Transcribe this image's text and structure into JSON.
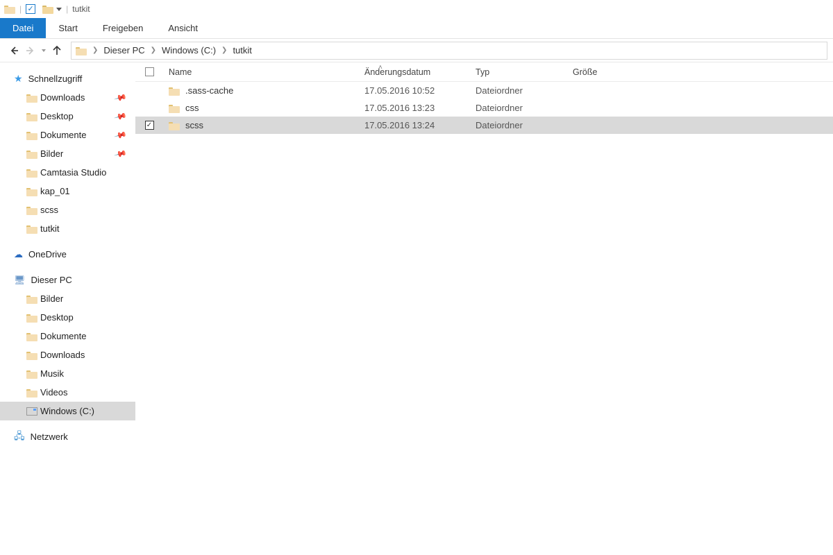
{
  "title": "tutkit",
  "ribbon": {
    "file": "Datei",
    "tabs": [
      "Start",
      "Freigeben",
      "Ansicht"
    ]
  },
  "breadcrumb": [
    "Dieser PC",
    "Windows (C:)",
    "tutkit"
  ],
  "columns": {
    "name": "Name",
    "date": "Änderungsdatum",
    "type": "Typ",
    "size": "Größe"
  },
  "rows": [
    {
      "name": ".sass-cache",
      "date": "17.05.2016 10:52",
      "type": "Dateiordner",
      "size": "",
      "selected": false
    },
    {
      "name": "css",
      "date": "17.05.2016 13:23",
      "type": "Dateiordner",
      "size": "",
      "selected": false
    },
    {
      "name": "scss",
      "date": "17.05.2016 13:24",
      "type": "Dateiordner",
      "size": "",
      "selected": true
    }
  ],
  "sidebar": {
    "quick": {
      "label": "Schnellzugriff",
      "items": [
        {
          "label": "Downloads",
          "pinned": true
        },
        {
          "label": "Desktop",
          "pinned": true
        },
        {
          "label": "Dokumente",
          "pinned": true
        },
        {
          "label": "Bilder",
          "pinned": true
        },
        {
          "label": "Camtasia Studio",
          "pinned": false
        },
        {
          "label": "kap_01",
          "pinned": false
        },
        {
          "label": "scss",
          "pinned": false
        },
        {
          "label": "tutkit",
          "pinned": false
        }
      ]
    },
    "onedrive": "OneDrive",
    "pc": {
      "label": "Dieser PC",
      "items": [
        "Bilder",
        "Desktop",
        "Dokumente",
        "Downloads",
        "Musik",
        "Videos",
        "Windows (C:)"
      ],
      "selected": "Windows (C:)"
    },
    "network": "Netzwerk"
  }
}
